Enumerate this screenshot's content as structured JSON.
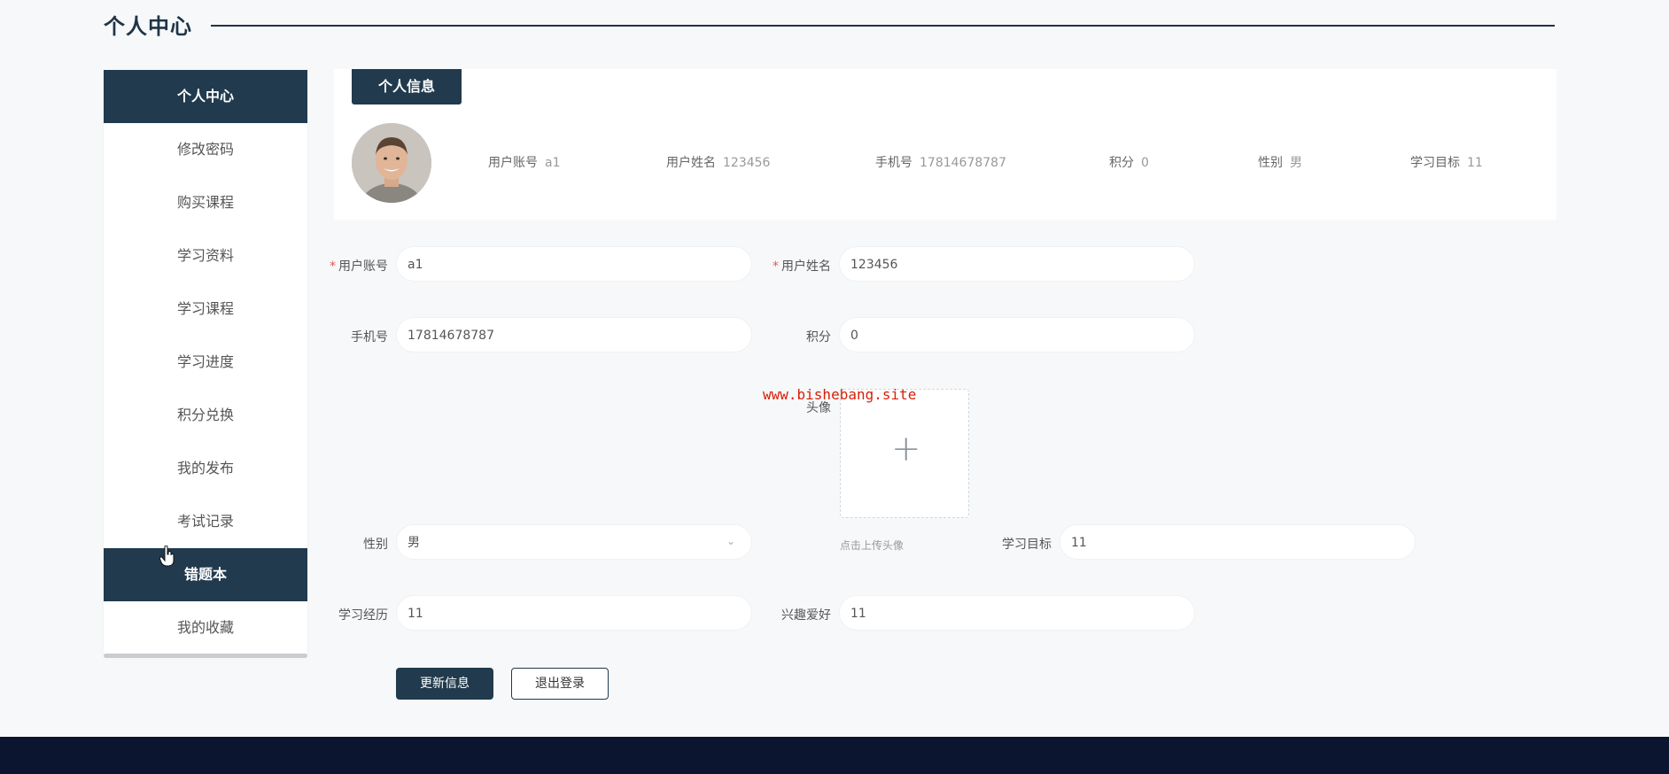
{
  "header": {
    "title": "个人中心"
  },
  "sidebar": {
    "items": [
      {
        "label": "个人中心",
        "active": true
      },
      {
        "label": "修改密码",
        "active": false
      },
      {
        "label": "购买课程",
        "active": false
      },
      {
        "label": "学习资料",
        "active": false
      },
      {
        "label": "学习课程",
        "active": false
      },
      {
        "label": "学习进度",
        "active": false
      },
      {
        "label": "积分兑换",
        "active": false
      },
      {
        "label": "我的发布",
        "active": false
      },
      {
        "label": "考试记录",
        "active": false
      },
      {
        "label": "错题本",
        "active": true
      },
      {
        "label": "我的收藏",
        "active": false
      }
    ]
  },
  "info_card": {
    "tab_label": "个人信息",
    "avatar_icon": "user-avatar-photo",
    "fields": [
      {
        "key": "用户账号",
        "value": "a1"
      },
      {
        "key": "用户姓名",
        "value": "123456"
      },
      {
        "key": "手机号",
        "value": "17814678787"
      },
      {
        "key": "积分",
        "value": "0"
      },
      {
        "key": "性别",
        "value": "男"
      },
      {
        "key": "学习目标",
        "value": "11"
      }
    ]
  },
  "form": {
    "username": {
      "label": "用户账号",
      "value": "a1",
      "required": "*"
    },
    "realname": {
      "label": "用户姓名",
      "value": "123456",
      "required": "*"
    },
    "phone": {
      "label": "手机号",
      "value": "17814678787"
    },
    "points": {
      "label": "积分",
      "value": "0"
    },
    "avatar": {
      "label": "头像",
      "tip": "点击上传头像",
      "plus": "+"
    },
    "gender": {
      "label": "性别",
      "value": "男",
      "arrow": "⌄"
    },
    "goal": {
      "label": "学习目标",
      "value": "11"
    },
    "experience": {
      "label": "学习经历",
      "value": "11"
    },
    "hobby": {
      "label": "兴趣爱好",
      "value": "11"
    }
  },
  "buttons": {
    "update": "更新信息",
    "logout": "退出登录"
  },
  "watermark": "www.bishebang.site",
  "colors": {
    "primary": "#213a4d",
    "footer": "#0c1530",
    "required": "#e05a5a"
  }
}
